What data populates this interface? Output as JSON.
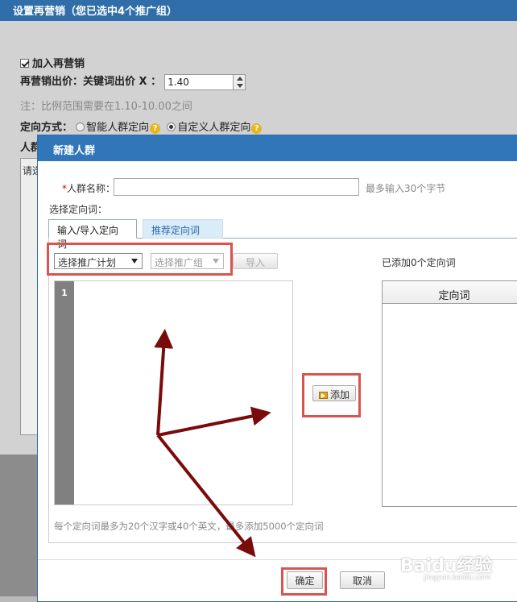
{
  "background_dialog": {
    "title": "设置再营销（您已选中4个推广组）",
    "join_remarketing": "加入再营销",
    "bid_label": "再营销出价：关键词出价 X ：",
    "bid_value": "1.40",
    "note": "注：比例范围需要在1.10-10.00之间",
    "targeting_label": "定向方式：",
    "targeting_options": [
      "智能人群定向",
      "自定义人群定向"
    ],
    "help_glyph": "?",
    "crowd_label_stub": "人群",
    "box_stub_text": "请选"
  },
  "modal": {
    "title": "新建人群",
    "name_required": "*",
    "name_label": "人群名称：",
    "name_value": "",
    "name_hint": "最多输入30个字节",
    "select_words_label": "选择定向词：",
    "tabs": [
      "输入/导入定向词",
      "推荐定向词"
    ],
    "plan_select": "选择推广计划",
    "group_select": "选择推广组",
    "import_button": "导入",
    "added_count": "已添加0个定向词",
    "line_number": "1",
    "add_button": "添加",
    "table_header": "定向词",
    "limit_hint": "每个定向词最多为20个汉字或40个英文，最多添加5000个定向词",
    "ok_button": "确定",
    "cancel_button": "取消"
  },
  "watermark": {
    "brand": "Baidu经验",
    "url": "jingyan.baidu.com"
  },
  "colors": {
    "header_blue": "#3076b8",
    "highlight_red": "#d9534f",
    "arrow_dark_red": "#7a0b0b"
  }
}
